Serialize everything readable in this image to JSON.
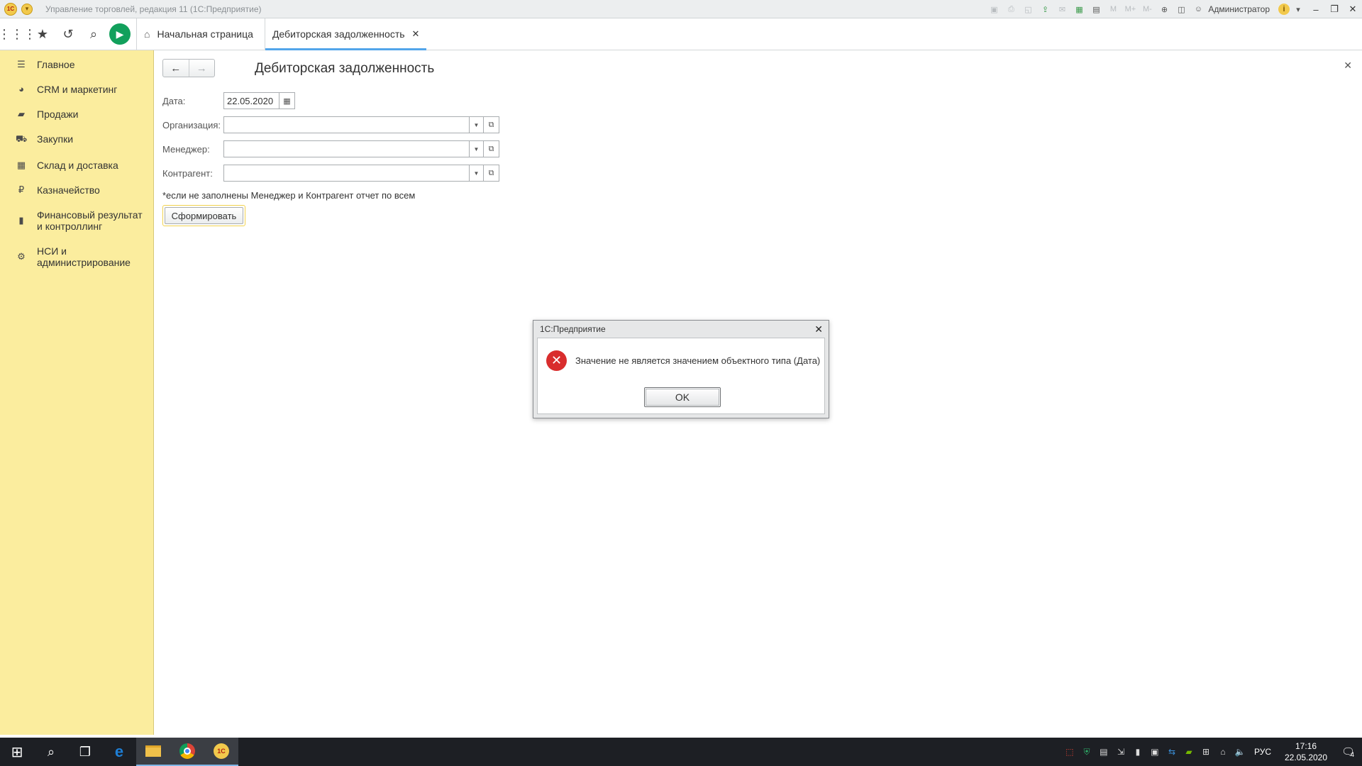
{
  "titlebar": {
    "logo": "1С",
    "title": "Управление торговлей, редакция 11  (1С:Предприятие)",
    "user": "Администратор",
    "icons": [
      "save-icon",
      "print-icon",
      "preview-icon",
      "upload-icon",
      "mail-icon",
      "table-icon",
      "calendar-icon",
      "m-icon",
      "m-plus-icon",
      "m-minus-icon",
      "zoom-icon",
      "panels-icon",
      "user-icon",
      "info-icon"
    ],
    "m_label": "M",
    "m_plus_label": "M+",
    "m_minus_label": "M-"
  },
  "toolbar": {
    "home_tab": "Начальная страница",
    "active_tab": "Дебиторская задолженность"
  },
  "sidebar": {
    "items": [
      {
        "label": "Главное",
        "icon": "menu-lines-icon"
      },
      {
        "label": "CRM и маркетинг",
        "icon": "pie-chart-icon"
      },
      {
        "label": "Продажи",
        "icon": "shopping-bag-icon"
      },
      {
        "label": "Закупки",
        "icon": "cart-icon"
      },
      {
        "label": "Склад и доставка",
        "icon": "grid-icon"
      },
      {
        "label": "Казначейство",
        "icon": "ruble-coin-icon"
      },
      {
        "label": "Финансовый результат и контроллинг",
        "icon": "bar-chart-icon"
      },
      {
        "label": "НСИ и администрирование",
        "icon": "gear-icon"
      }
    ]
  },
  "form": {
    "title": "Дебиторская задолженность",
    "date_label": "Дата:",
    "date_value": "22.05.2020",
    "org_label": "Организация:",
    "manager_label": "Менеджер:",
    "counterparty_label": "Контрагент:",
    "note": "*если не заполнены Менеджер и Контрагент отчет по всем",
    "generate_button": "Сформировать"
  },
  "dialog": {
    "title": "1С:Предприятие",
    "message": "Значение не является значением объектного типа (Дата)",
    "ok_button": "OK"
  },
  "taskbar": {
    "apps": [
      "windows-start-icon",
      "search-icon",
      "task-view-icon",
      "edge-icon",
      "file-explorer-icon",
      "chrome-icon",
      "1c-app-icon"
    ],
    "app_1c_label": "1С",
    "language": "РУС",
    "time": "17:16",
    "date": "22.05.2020",
    "notifications_count": "4"
  },
  "colors": {
    "sidebar_bg": "#fbed9e",
    "accent_tab": "#52a5ea",
    "go_button": "#12a05c",
    "error_icon": "#d92d2d",
    "taskbar_bg": "#1d1f24"
  }
}
